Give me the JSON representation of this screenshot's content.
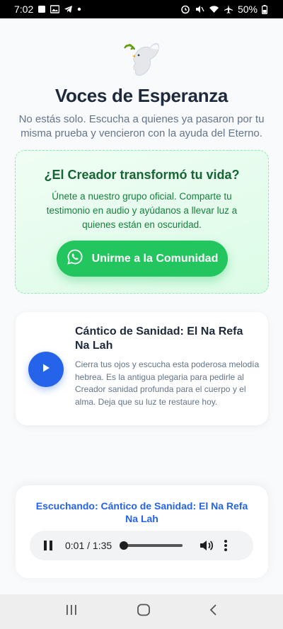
{
  "status_bar": {
    "time": "7:02",
    "battery": "50%"
  },
  "header": {
    "logo_icon": "dove-icon",
    "title": "Voces de Esperanza",
    "subtitle": "No estás solo. Escucha a quienes ya pasaron por tu misma prueba y vencieron con la ayuda del Eterno."
  },
  "community": {
    "title": "¿El Creador transformó tu vida?",
    "description": "Únete a nuestro grupo oficial. Comparte tu testimonio en audio y ayúdanos a llevar luz a quienes están en oscuridad.",
    "button_label": "Unirme a la Comunidad",
    "button_icon": "whatsapp-icon"
  },
  "track": {
    "title": "Cántico de Sanidad: El Na Refa Na Lah",
    "description": "Cierra tus ojos y escucha esta poderosa melodía hebrea. Es la antigua plegaria para pedirle al Creador sanidad profunda para el cuerpo y el alma. Deja que su luz te restaure hoy.",
    "play_icon": "play-icon"
  },
  "player": {
    "now_playing": "Escuchando: Cántico de Sanidad: El Na Refa Na Lah",
    "time": "0:01 / 1:35",
    "progress": 0.01
  },
  "colors": {
    "accent_blue": "#2563eb",
    "whatsapp_green": "#22c55e",
    "community_text": "#166534"
  }
}
